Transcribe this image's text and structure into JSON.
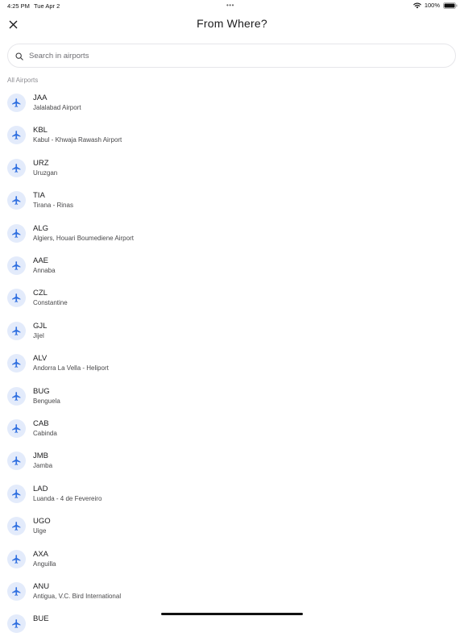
{
  "status_bar": {
    "time": "4:25 PM",
    "date": "Tue Apr 2",
    "dots": "•••",
    "battery": "100%"
  },
  "header": {
    "title": "From Where?",
    "close_icon": "close-icon"
  },
  "search": {
    "placeholder": "Search in airports",
    "value": "",
    "icon": "search-icon"
  },
  "section_label": "All Airports",
  "colors": {
    "accent": "#2f6fe0",
    "badge_bg": "#e3ebfb"
  },
  "airports": [
    {
      "code": "JAA",
      "name": "Jalalabad Airport"
    },
    {
      "code": "KBL",
      "name": "Kabul - Khwaja Rawash Airport"
    },
    {
      "code": "URZ",
      "name": "Uruzgan"
    },
    {
      "code": "TIA",
      "name": "Tirana - Rinas"
    },
    {
      "code": "ALG",
      "name": "Algiers, Houari Boumediene Airport"
    },
    {
      "code": "AAE",
      "name": "Annaba"
    },
    {
      "code": "CZL",
      "name": "Constantine"
    },
    {
      "code": "GJL",
      "name": "Jijel"
    },
    {
      "code": "ALV",
      "name": "Andorra La Vella - Heliport"
    },
    {
      "code": "BUG",
      "name": "Benguela"
    },
    {
      "code": "CAB",
      "name": "Cabinda"
    },
    {
      "code": "JMB",
      "name": "Jamba"
    },
    {
      "code": "LAD",
      "name": "Luanda - 4 de Fevereiro"
    },
    {
      "code": "UGO",
      "name": "Uige"
    },
    {
      "code": "AXA",
      "name": "Anguilla"
    },
    {
      "code": "ANU",
      "name": "Antigua, V.C. Bird International"
    },
    {
      "code": "BUE",
      "name": ""
    }
  ]
}
